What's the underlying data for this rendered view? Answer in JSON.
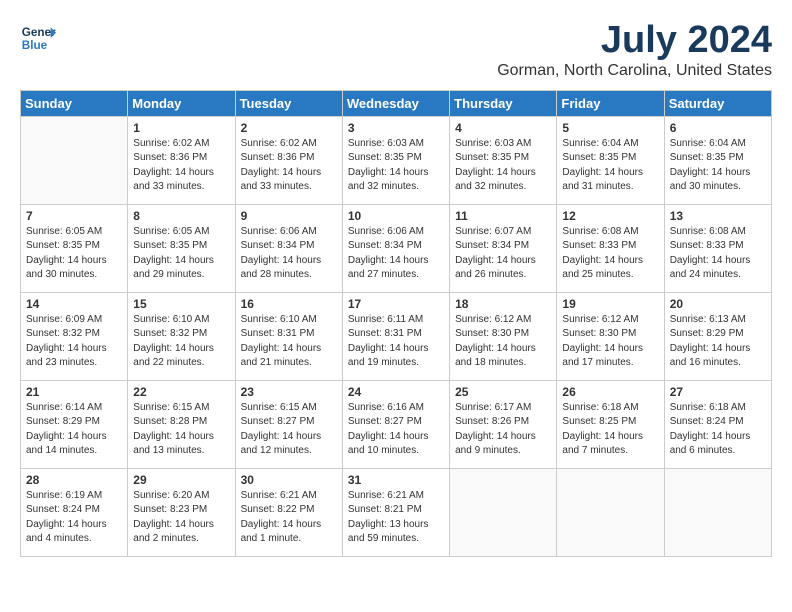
{
  "header": {
    "logo_line1": "General",
    "logo_line2": "Blue",
    "month": "July 2024",
    "location": "Gorman, North Carolina, United States"
  },
  "days_of_week": [
    "Sunday",
    "Monday",
    "Tuesday",
    "Wednesday",
    "Thursday",
    "Friday",
    "Saturday"
  ],
  "weeks": [
    [
      {
        "num": "",
        "info": ""
      },
      {
        "num": "1",
        "info": "Sunrise: 6:02 AM\nSunset: 8:36 PM\nDaylight: 14 hours\nand 33 minutes."
      },
      {
        "num": "2",
        "info": "Sunrise: 6:02 AM\nSunset: 8:36 PM\nDaylight: 14 hours\nand 33 minutes."
      },
      {
        "num": "3",
        "info": "Sunrise: 6:03 AM\nSunset: 8:35 PM\nDaylight: 14 hours\nand 32 minutes."
      },
      {
        "num": "4",
        "info": "Sunrise: 6:03 AM\nSunset: 8:35 PM\nDaylight: 14 hours\nand 32 minutes."
      },
      {
        "num": "5",
        "info": "Sunrise: 6:04 AM\nSunset: 8:35 PM\nDaylight: 14 hours\nand 31 minutes."
      },
      {
        "num": "6",
        "info": "Sunrise: 6:04 AM\nSunset: 8:35 PM\nDaylight: 14 hours\nand 30 minutes."
      }
    ],
    [
      {
        "num": "7",
        "info": "Sunrise: 6:05 AM\nSunset: 8:35 PM\nDaylight: 14 hours\nand 30 minutes."
      },
      {
        "num": "8",
        "info": "Sunrise: 6:05 AM\nSunset: 8:35 PM\nDaylight: 14 hours\nand 29 minutes."
      },
      {
        "num": "9",
        "info": "Sunrise: 6:06 AM\nSunset: 8:34 PM\nDaylight: 14 hours\nand 28 minutes."
      },
      {
        "num": "10",
        "info": "Sunrise: 6:06 AM\nSunset: 8:34 PM\nDaylight: 14 hours\nand 27 minutes."
      },
      {
        "num": "11",
        "info": "Sunrise: 6:07 AM\nSunset: 8:34 PM\nDaylight: 14 hours\nand 26 minutes."
      },
      {
        "num": "12",
        "info": "Sunrise: 6:08 AM\nSunset: 8:33 PM\nDaylight: 14 hours\nand 25 minutes."
      },
      {
        "num": "13",
        "info": "Sunrise: 6:08 AM\nSunset: 8:33 PM\nDaylight: 14 hours\nand 24 minutes."
      }
    ],
    [
      {
        "num": "14",
        "info": "Sunrise: 6:09 AM\nSunset: 8:32 PM\nDaylight: 14 hours\nand 23 minutes."
      },
      {
        "num": "15",
        "info": "Sunrise: 6:10 AM\nSunset: 8:32 PM\nDaylight: 14 hours\nand 22 minutes."
      },
      {
        "num": "16",
        "info": "Sunrise: 6:10 AM\nSunset: 8:31 PM\nDaylight: 14 hours\nand 21 minutes."
      },
      {
        "num": "17",
        "info": "Sunrise: 6:11 AM\nSunset: 8:31 PM\nDaylight: 14 hours\nand 19 minutes."
      },
      {
        "num": "18",
        "info": "Sunrise: 6:12 AM\nSunset: 8:30 PM\nDaylight: 14 hours\nand 18 minutes."
      },
      {
        "num": "19",
        "info": "Sunrise: 6:12 AM\nSunset: 8:30 PM\nDaylight: 14 hours\nand 17 minutes."
      },
      {
        "num": "20",
        "info": "Sunrise: 6:13 AM\nSunset: 8:29 PM\nDaylight: 14 hours\nand 16 minutes."
      }
    ],
    [
      {
        "num": "21",
        "info": "Sunrise: 6:14 AM\nSunset: 8:29 PM\nDaylight: 14 hours\nand 14 minutes."
      },
      {
        "num": "22",
        "info": "Sunrise: 6:15 AM\nSunset: 8:28 PM\nDaylight: 14 hours\nand 13 minutes."
      },
      {
        "num": "23",
        "info": "Sunrise: 6:15 AM\nSunset: 8:27 PM\nDaylight: 14 hours\nand 12 minutes."
      },
      {
        "num": "24",
        "info": "Sunrise: 6:16 AM\nSunset: 8:27 PM\nDaylight: 14 hours\nand 10 minutes."
      },
      {
        "num": "25",
        "info": "Sunrise: 6:17 AM\nSunset: 8:26 PM\nDaylight: 14 hours\nand 9 minutes."
      },
      {
        "num": "26",
        "info": "Sunrise: 6:18 AM\nSunset: 8:25 PM\nDaylight: 14 hours\nand 7 minutes."
      },
      {
        "num": "27",
        "info": "Sunrise: 6:18 AM\nSunset: 8:24 PM\nDaylight: 14 hours\nand 6 minutes."
      }
    ],
    [
      {
        "num": "28",
        "info": "Sunrise: 6:19 AM\nSunset: 8:24 PM\nDaylight: 14 hours\nand 4 minutes."
      },
      {
        "num": "29",
        "info": "Sunrise: 6:20 AM\nSunset: 8:23 PM\nDaylight: 14 hours\nand 2 minutes."
      },
      {
        "num": "30",
        "info": "Sunrise: 6:21 AM\nSunset: 8:22 PM\nDaylight: 14 hours\nand 1 minute."
      },
      {
        "num": "31",
        "info": "Sunrise: 6:21 AM\nSunset: 8:21 PM\nDaylight: 13 hours\nand 59 minutes."
      },
      {
        "num": "",
        "info": ""
      },
      {
        "num": "",
        "info": ""
      },
      {
        "num": "",
        "info": ""
      }
    ]
  ]
}
